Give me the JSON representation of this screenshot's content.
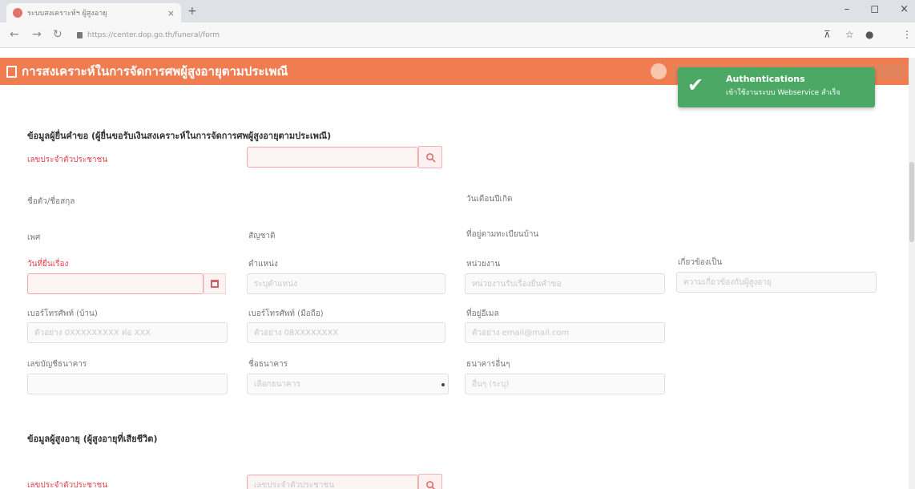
{
  "browser": {
    "tab_title": "ระบบสงเคราะห์ฯ ผู้สูงอายุ",
    "url": "https://center.dop.go.th/funeral/form",
    "controls": {
      "minimize": "–",
      "maximize": "◻",
      "close": "×"
    }
  },
  "header": {
    "title": "การสงเคราะห์ในการจัดการศพผู้สูงอายุตามประเพณี"
  },
  "toast": {
    "title": "Authentications",
    "message": "เข้าใช้งานระบบ Webservice สำเร็จ",
    "color": "#4ca865"
  },
  "applicant_section": {
    "title": "ข้อมูลผู้ยื่นคำขอ (ผู้ยื่นขอรับเงินสงเคราะห์ในการจัดการศพผู้สูงอายุตามประเพณี)",
    "citizen_id_label": "เลขประจำตัวประชาชน",
    "citizen_id_placeholder": "",
    "name_label": "ชื่อตัว/ชื่อสกุล",
    "birthdate_label": "วันเดือนปีเกิด",
    "gender_label": "เพศ",
    "nationality_label": "สัญชาติ",
    "address_label": "ที่อยู่ตามทะเบียนบ้าน",
    "request_date_label": "วันที่ยื่นเรื่อง",
    "request_date_value": "",
    "position_label": "ตำแหน่ง",
    "position_placeholder": "ระบุตำแหน่ง",
    "agency_label": "หน่วยงาน",
    "agency_placeholder": "หน่วยงานรับเรื่องยื่นคำขอ",
    "relation_label": "เกี่ยวข้องเป็น",
    "relation_placeholder": "ความเกี่ยวข้องกับผู้สูงอายุ",
    "home_phone_label": "เบอร์โทรศัพท์ (บ้าน)",
    "home_phone_placeholder": "ตัวอย่าง 0XXXXXXXXX ต่อ XXX",
    "mobile_label": "เบอร์โทรศัพท์ (มือถือ)",
    "mobile_placeholder": "ตัวอย่าง 08XXXXXXXX",
    "email_label": "ที่อยู่อีเมล",
    "email_placeholder": "ตัวอย่าง email@mail.com",
    "bank_account_label": "เลขบัญชีธนาคาร",
    "bank_account_placeholder": "",
    "bank_name_label": "ชื่อธนาคาร",
    "bank_name_placeholder": "เลือกธนาคาร",
    "other_bank_label": "ธนาคารอื่นๆ",
    "other_bank_placeholder": "อื่นๆ (ระบุ)"
  },
  "deceased_section": {
    "title": "ข้อมูลผู้สูงอายุ (ผู้สูงอายุที่เสียชีวิต)",
    "citizen_id_label": "เลขประจำตัวประชาชน",
    "citizen_id_placeholder": "เลขประจำตัวประชาชน"
  }
}
